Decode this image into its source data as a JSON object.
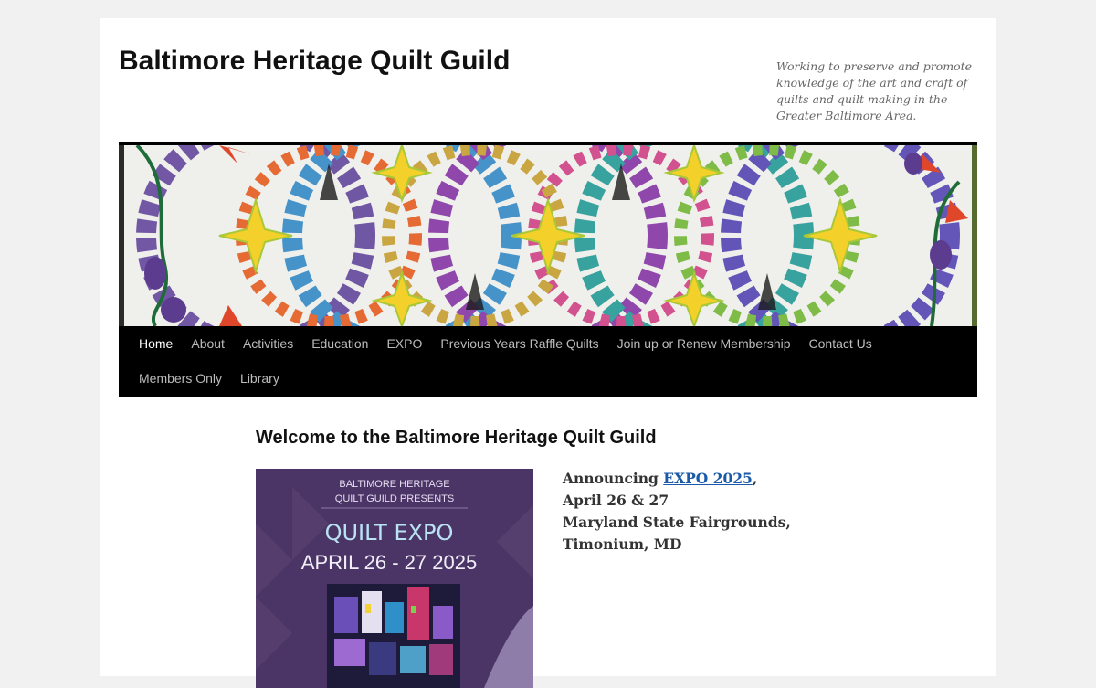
{
  "site": {
    "title": "Baltimore Heritage Quilt Guild",
    "description": "Working to preserve and promote knowledge of the art and craft of quilts and quilt making in the Greater Baltimore Area."
  },
  "nav": {
    "items": [
      {
        "label": "Home",
        "current": true
      },
      {
        "label": "About"
      },
      {
        "label": "Activities"
      },
      {
        "label": "Education"
      },
      {
        "label": "EXPO"
      },
      {
        "label": "Previous Years Raffle Quilts"
      },
      {
        "label": "Join up or Renew Membership"
      },
      {
        "label": "Contact Us"
      },
      {
        "label": "Members Only"
      },
      {
        "label": "Library"
      }
    ]
  },
  "content": {
    "title": "Welcome to the Baltimore Heritage Quilt Guild",
    "poster": {
      "line1": "BALTIMORE HERITAGE",
      "line2": "QUILT GUILD PRESENTS",
      "headline": "QUILT EXPO",
      "dates": "APRIL 26 - 27 2025"
    },
    "announcement": {
      "prefix": "Announcing ",
      "link_text": "EXPO 2025",
      "suffix": ",",
      "dates": "April 26 & 27",
      "venue": "Maryland State Fairgrounds,",
      "city": "Timonium, MD"
    }
  },
  "colors": {
    "nav_bg": "#000000",
    "page_bg": "#f1f1f1",
    "link": "#1b5aa8",
    "poster_bg": "#4b3566"
  }
}
